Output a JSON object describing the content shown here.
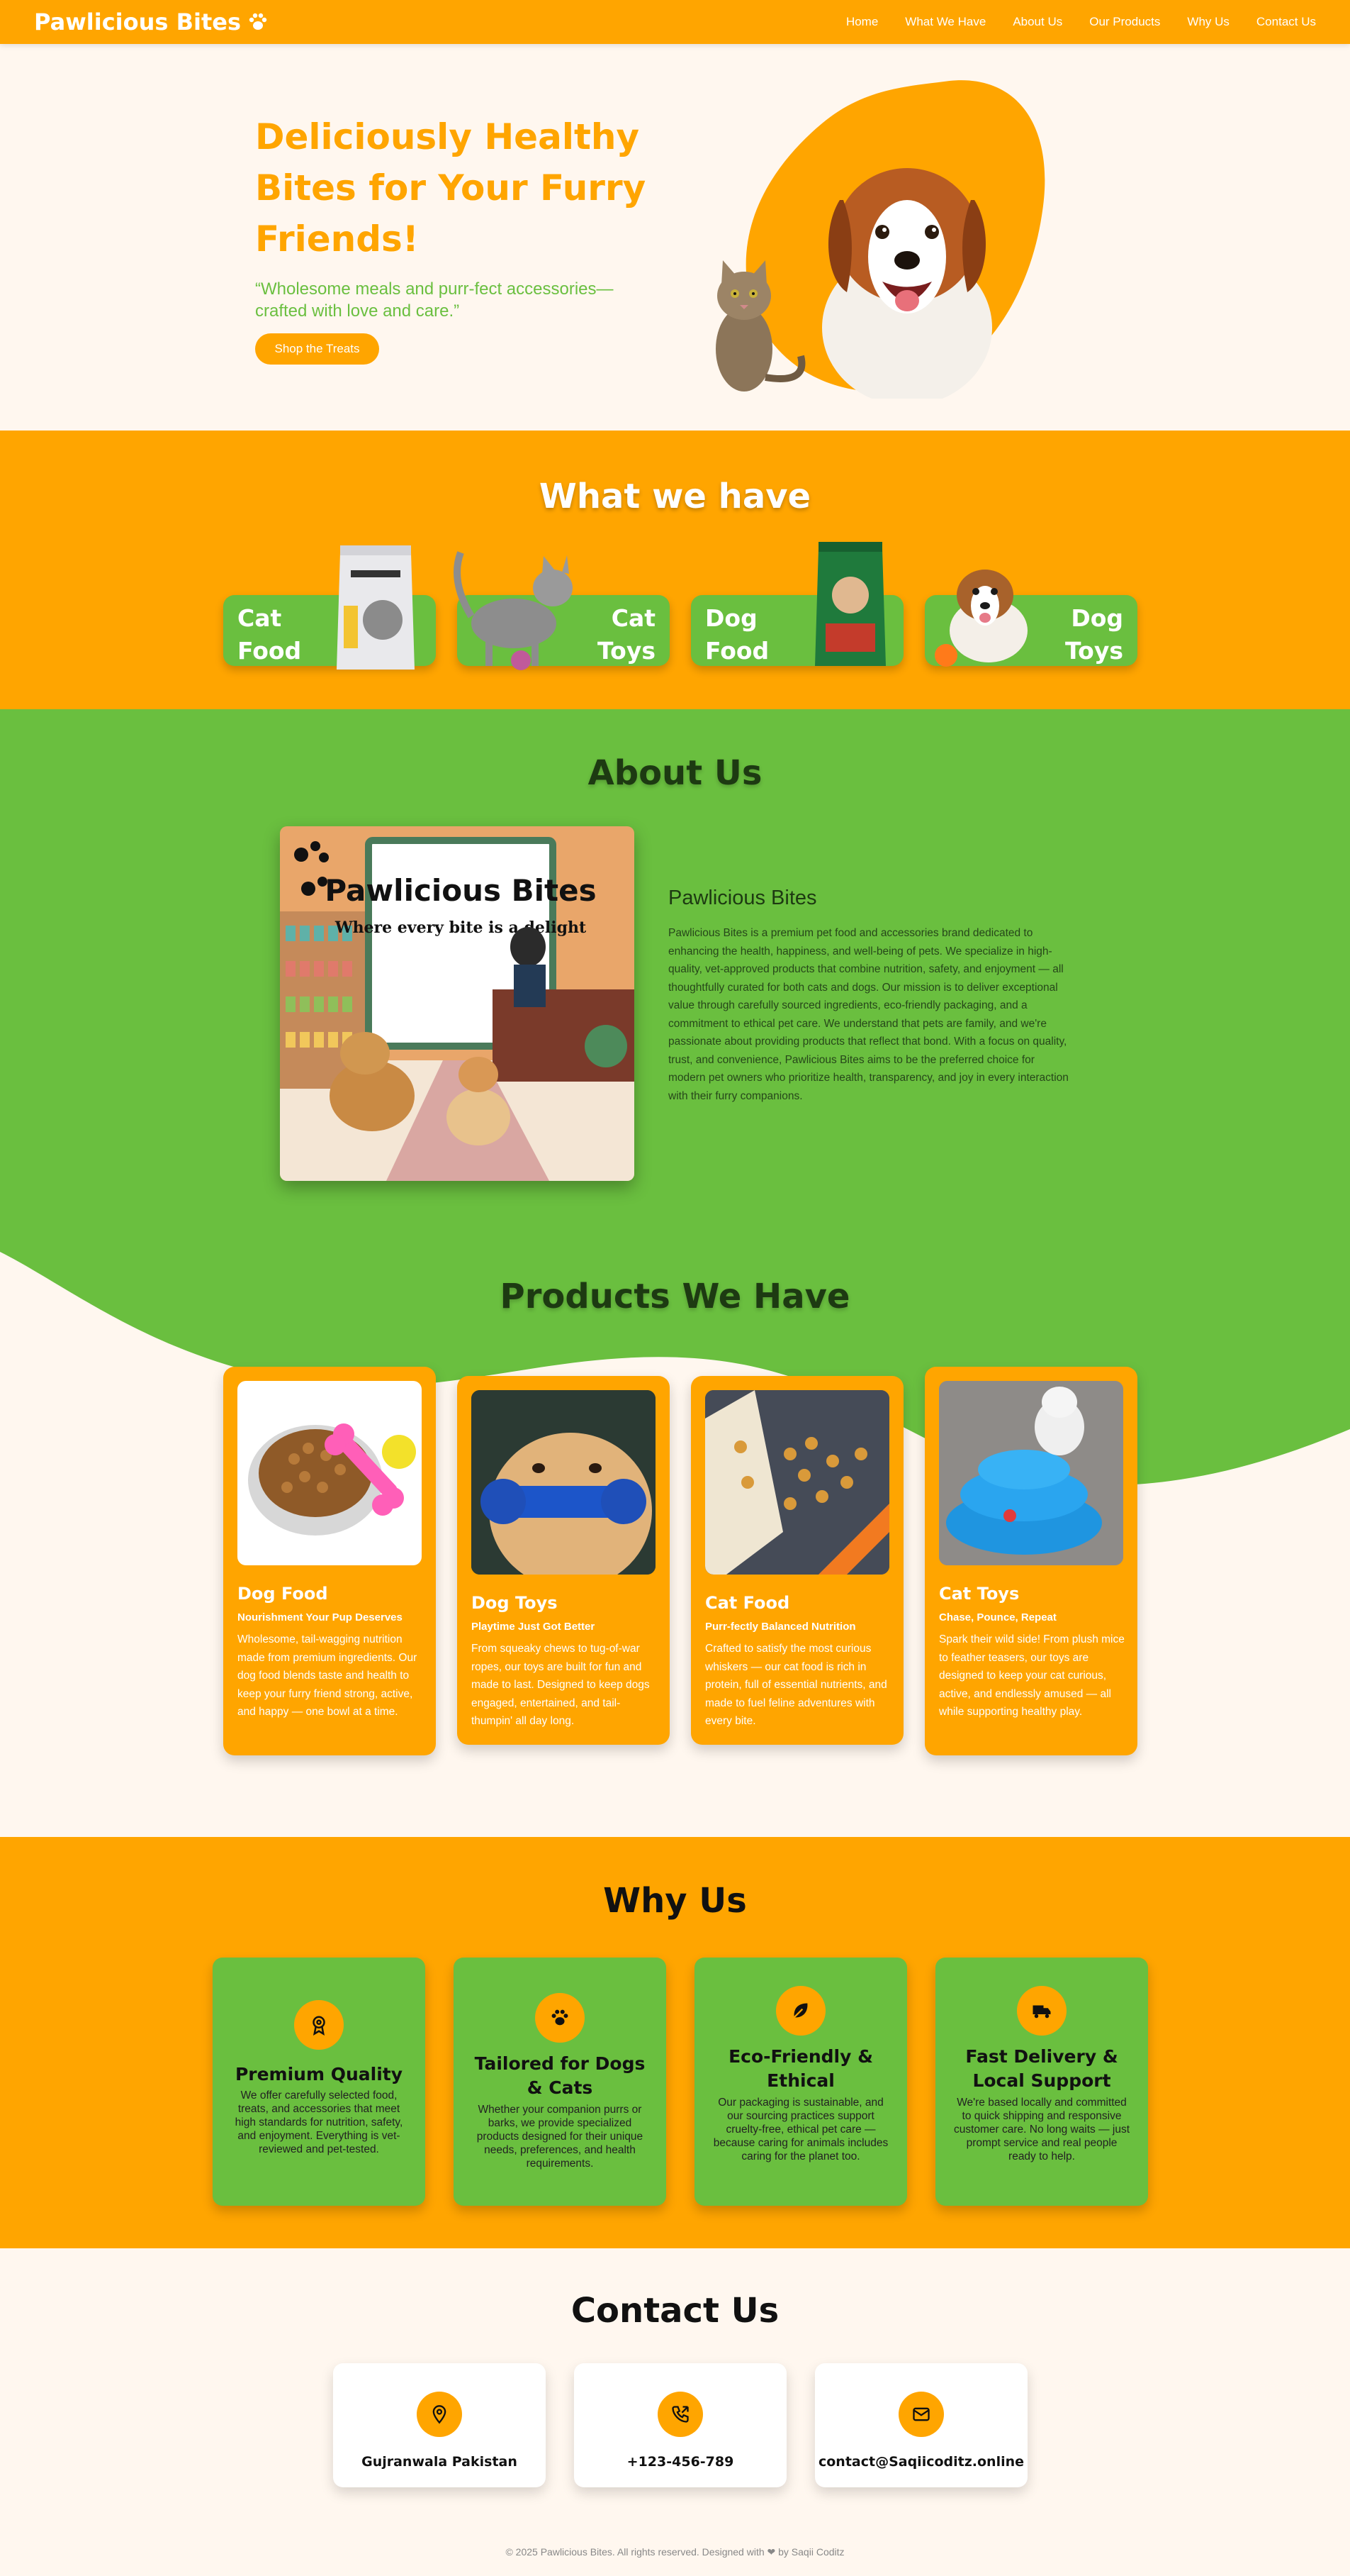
{
  "brand": {
    "name": "Pawlicious Bites",
    "icon": "paw-icon"
  },
  "nav": {
    "items": [
      "Home",
      "What We Have",
      "About Us",
      "Our Products",
      "Why Us",
      "Contact Us"
    ]
  },
  "hero": {
    "title": "Deliciously Healthy Bites for Your Furry Friends!",
    "subtitle": "“Wholesome meals and purr-fect accessories—crafted with love and care.”",
    "cta": "Shop the Treats"
  },
  "have": {
    "title": "What we have",
    "categories": [
      {
        "label_line1": "Cat",
        "label_line2": "Food"
      },
      {
        "label_line1": "Cat",
        "label_line2": "Toys"
      },
      {
        "label_line1": "Dog",
        "label_line2": "Food"
      },
      {
        "label_line1": "Dog",
        "label_line2": "Toys"
      }
    ]
  },
  "about": {
    "title": "About Us",
    "heading": "Pawlicious Bites",
    "text": "Pawlicious Bites is a premium pet food and accessories brand dedicated to enhancing the health, happiness, and well-being of pets. We specialize in high-quality, vet-approved products that combine nutrition, safety, and enjoyment — all thoughtfully curated for both cats and dogs. Our mission is to deliver exceptional value through carefully sourced ingredients, eco-friendly packaging, and a commitment to ethical pet care. We understand that pets are family, and we're passionate about providing products that reflect that bond. With a focus on quality, trust, and convenience, Pawlicious Bites aims to be the preferred choice for modern pet owners who prioritize health, transparency, and joy in every interaction with their furry companions.",
    "poster_brand": "Pawlicious Bites",
    "poster_tagline": "Where every bite is a delight"
  },
  "products": {
    "title": "Products We Have",
    "items": [
      {
        "name": "Dog Food",
        "tagline": "Nourishment Your Pup Deserves",
        "desc": "Wholesome, tail-wagging nutrition made from premium ingredients. Our dog food blends taste and health to keep your furry friend strong, active, and happy — one bowl at a time."
      },
      {
        "name": "Dog Toys",
        "tagline": "Playtime Just Got Better",
        "desc": "From squeaky chews to tug-of-war ropes, our toys are built for fun and made to last. Designed to keep dogs engaged, entertained, and tail-thumpin' all day long."
      },
      {
        "name": "Cat Food",
        "tagline": "Purr-fectly Balanced Nutrition",
        "desc": "Crafted to satisfy the most curious whiskers — our cat food is rich in protein, full of essential nutrients, and made to fuel feline adventures with every bite."
      },
      {
        "name": "Cat Toys",
        "tagline": "Chase, Pounce, Repeat",
        "desc": "Spark their wild side! From plush mice to feather teasers, our toys are designed to keep your cat curious, active, and endlessly amused — all while supporting healthy play."
      }
    ]
  },
  "why": {
    "title": "Why Us",
    "items": [
      {
        "icon": "award-icon",
        "title": "Premium Quality",
        "text": "We offer carefully selected food, treats, and accessories that meet high standards for nutrition, safety, and enjoyment. Everything is vet-reviewed and pet-tested."
      },
      {
        "icon": "paw-icon",
        "title": "Tailored for Dogs & Cats",
        "text": "Whether your companion purrs or barks, we provide specialized products designed for their unique needs, preferences, and health requirements."
      },
      {
        "icon": "leaf-icon",
        "title": "Eco-Friendly & Ethical",
        "text": "Our packaging is sustainable, and our sourcing practices support cruelty-free, ethical pet care — because caring for animals includes caring for the planet too."
      },
      {
        "icon": "truck-icon",
        "title": "Fast Delivery & Local Support",
        "text": "We're based locally and committed to quick shipping and responsive customer care. No long waits — just prompt service and real people ready to help."
      }
    ]
  },
  "contact": {
    "title": "Contact Us",
    "items": [
      {
        "icon": "location-icon",
        "text": "Gujranwala Pakistan"
      },
      {
        "icon": "phone-icon",
        "text": "+123-456-789"
      },
      {
        "icon": "mail-icon",
        "text": "contact@Saqiicoditz.online"
      }
    ]
  },
  "footer": {
    "text": "© 2025 Pawlicious Bites. All rights reserved. Designed with ❤ by Saqii Coditz"
  },
  "colors": {
    "orange": "#ffa500",
    "green": "#6abf3f",
    "cream": "#fff7ef",
    "dark_green": "#1d3a12"
  }
}
